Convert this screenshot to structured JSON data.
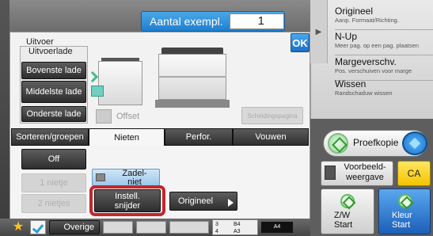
{
  "copies": {
    "label": "Aantal exempl.",
    "value": "1"
  },
  "sidebar": {
    "items": [
      {
        "title": "Origineel",
        "subtitle": "Aanp. Formaat/Richting."
      },
      {
        "title": "N-Up",
        "subtitle": "Meer pag. op een pag. plaatsen"
      },
      {
        "title": "Margeverschv.",
        "subtitle": "Pos. verschuiven voor marge"
      },
      {
        "title": "Wissen",
        "subtitle": "Randschaduw wissen"
      }
    ]
  },
  "controls": {
    "preview": "Proefkopie",
    "preview_view": "Voorbeeld-weergave",
    "ca": "CA",
    "bw_start": "Z/W\nStart",
    "color_start": "Kleur\nStart"
  },
  "dialog": {
    "title": "Uitvoer",
    "ok": "OK",
    "tray_group_label": "Uitvoerlade",
    "trays": [
      "Bovenste lade",
      "Middelste lade",
      "Onderste lade"
    ],
    "offset_label": "Offset",
    "separator_page": "Scheidingspagina"
  },
  "tabs": [
    "Sorteren/groepen",
    "Nieten",
    "Perfor.",
    "Vouwen"
  ],
  "staple": {
    "off": "Off",
    "one_staple": "1 nietje",
    "two_staples": "2 nietjes",
    "saddle": "Zadel-\nniet",
    "cutter_settings": "Instell.\nsnijder",
    "original": "Origineel"
  },
  "bottom": {
    "other": "Overige",
    "paper_sizes": [
      "3",
      "B4",
      "4",
      "A3"
    ],
    "paper_current": "A4"
  }
}
